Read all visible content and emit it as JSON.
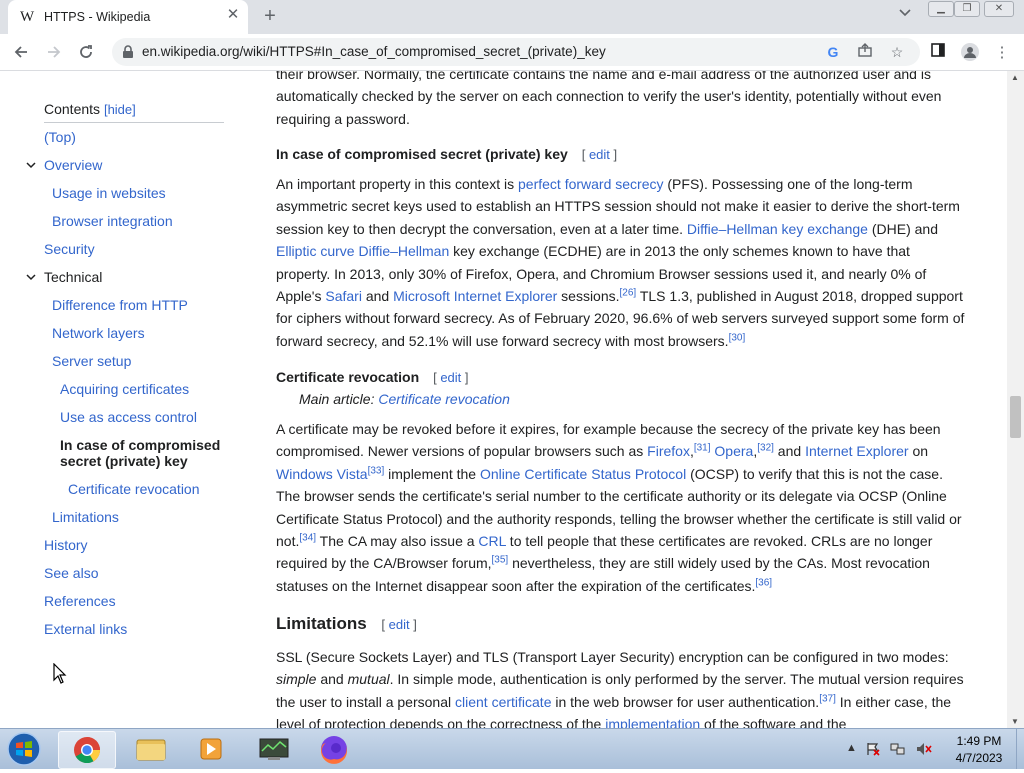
{
  "browser": {
    "tab": {
      "favicon": "W",
      "title": "HTTPS - Wikipedia"
    },
    "url": "en.wikipedia.org/wiki/HTTPS#In_case_of_compromised_secret_(private)_key"
  },
  "toc": {
    "title": "Contents",
    "hide_open": "[",
    "hide": "hide",
    "hide_close": "]",
    "items": [
      {
        "label": "(Top)"
      },
      {
        "label": "Overview"
      },
      {
        "label": "Usage in websites"
      },
      {
        "label": "Browser integration"
      },
      {
        "label": "Security"
      },
      {
        "label": "Technical"
      },
      {
        "label": "Difference from HTTP"
      },
      {
        "label": "Network layers"
      },
      {
        "label": "Server setup"
      },
      {
        "label": "Acquiring certificates"
      },
      {
        "label": "Use as access control"
      },
      {
        "label_line1": "In case of compromised",
        "label_line2": "secret (private) key"
      },
      {
        "label": "Certificate revocation"
      },
      {
        "label": "Limitations"
      },
      {
        "label": "History"
      },
      {
        "label": "See also"
      },
      {
        "label": "References"
      },
      {
        "label": "External links"
      }
    ]
  },
  "article": {
    "intro": {
      "line1": "their browser. Normally, the certificate contains the name and e-mail address of the authorized user and is",
      "line2": "automatically checked by the server on each connection to verify the user's identity, potentially without even",
      "line3": "requiring a password."
    },
    "edit_open": "[",
    "edit_label": "edit",
    "edit_close": "]",
    "sec1": {
      "heading": "In case of compromised secret (private) key",
      "p1": "An important property in this context is ",
      "link_pfs": "perfect forward secrecy",
      "p2": " (PFS). Possessing one of the long-term asymmetric secret keys used to establish an HTTPS session should not make it easier to derive the short-term session key to then decrypt the conversation, even at a later time. ",
      "link_dhe": "Diffie–Hellman key exchange",
      "p3": " (DHE) and ",
      "link_ecdhe": "Elliptic curve Diffie–Hellman",
      "p4": " key exchange (ECDHE) are in 2013 the only schemes known to have that property. In 2013, only 30% of Firefox, Opera, and Chromium Browser sessions used it, and nearly 0% of Apple's ",
      "link_safari": "Safari",
      "p5": " and ",
      "link_ie": "Microsoft Internet Explorer",
      "p6": " sessions.",
      "ref26": "[26]",
      "p7": " TLS 1.3, published in August 2018, dropped support for ciphers without forward secrecy. As of February 2020, 96.6% of web servers surveyed support some form of forward secrecy, and 52.1% will use forward secrecy with most browsers.",
      "ref30": "[30]"
    },
    "sec2": {
      "heading": "Certificate revocation",
      "main_article_label": "Main article: ",
      "main_article_link": "Certificate revocation",
      "p1": "A certificate may be revoked before it expires, for example because the secrecy of the private key has been compromised. Newer versions of popular browsers such as ",
      "link_firefox": "Firefox",
      "p1b": ",",
      "ref31": "[31]",
      "link_opera": "Opera",
      "p1c": ",",
      "ref32": "[32]",
      "p2": " and ",
      "link_ie": "Internet Explorer",
      "p3": " on ",
      "link_vista": "Windows Vista",
      "ref33": "[33]",
      "p4": " implement the ",
      "link_ocsp": "Online Certificate Status Protocol",
      "p5": " (OCSP) to verify that this is not the case. The browser sends the certificate's serial number to the certificate authority or its delegate via OCSP (Online Certificate Status Protocol) and the authority responds, telling the browser whether the certificate is still valid or not.",
      "ref34": "[34]",
      "p6": " The CA may also issue a ",
      "link_crl": "CRL",
      "p7": " to tell people that these certificates are revoked. CRLs are no longer required by the CA/Browser forum,",
      "ref35": "[35]",
      "p8": " nevertheless, they are still widely used by the CAs. Most revocation statuses on the Internet disappear soon after the expiration of the certificates.",
      "ref36": "[36]"
    },
    "sec3": {
      "heading": "Limitations",
      "p1": "SSL (Secure Sockets Layer) and TLS (Transport Layer Security) encryption can be configured in two modes: ",
      "em_simple": "simple",
      "p2": " and ",
      "em_mutual": "mutual",
      "p3": ". In simple mode, authentication is only performed by the server. The mutual version requires the user to install a personal ",
      "link_client": "client certificate",
      "p4": " in the web browser for user authentication.",
      "ref37": "[37]",
      "p5": " In either case, the level of protection depends on the correctness of the ",
      "link_impl": "implementation",
      "p6": " of the software and the"
    }
  },
  "taskbar": {
    "time": "1:49 PM",
    "date": "4/7/2023"
  }
}
